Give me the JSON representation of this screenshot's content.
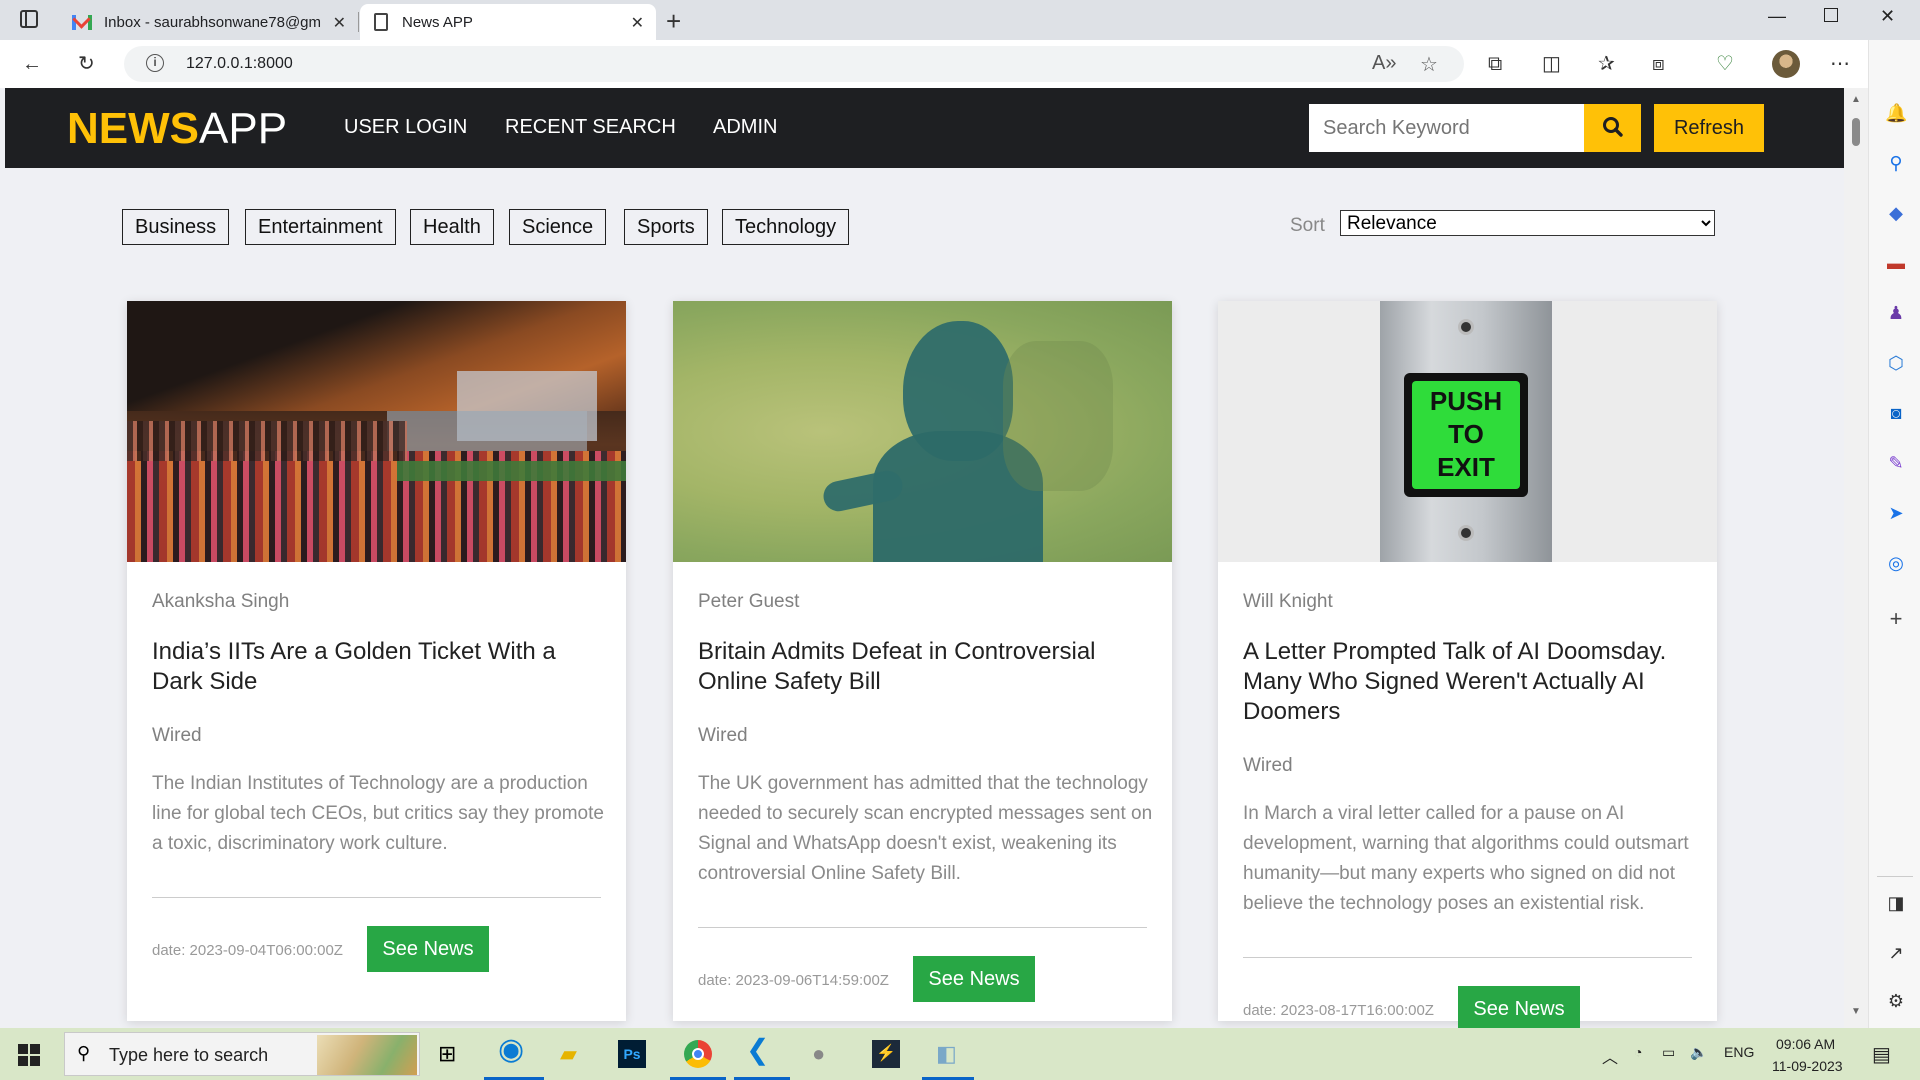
{
  "browser": {
    "tabs": [
      {
        "title": "Inbox - saurabhsonwane78@gm",
        "icon": "gmail-icon",
        "active": false
      },
      {
        "title": "News APP",
        "icon": "document-icon",
        "active": true
      }
    ],
    "url": "127.0.0.1:8000"
  },
  "app": {
    "brand_a": "NEWS",
    "brand_b": "APP",
    "nav": [
      "USER LOGIN",
      "RECENT SEARCH",
      "ADMIN"
    ],
    "search_placeholder": "Search Keyword",
    "refresh_label": "Refresh",
    "categories": [
      "Business",
      "Entertainment",
      "Health",
      "Science",
      "Sports",
      "Technology"
    ],
    "sort_label": "Sort",
    "sort_value": "Relevance",
    "colors": {
      "accent": "#ffc107",
      "header": "#1e1f22",
      "button": "#28a745"
    }
  },
  "articles": [
    {
      "author": "Akanksha Singh",
      "title": "India’s IITs Are a Golden Ticket With a Dark Side",
      "source": "Wired",
      "description": "The Indian Institutes of Technology are a production line for global tech CEOs, but critics say they promote a toxic, discriminatory work culture.",
      "date": "date: 2023-09-04T06:00:00Z",
      "button": "See News"
    },
    {
      "author": "Peter Guest",
      "title": "Britain Admits Defeat in Controversial Online Safety Bill",
      "source": "Wired",
      "description": "The UK government has admitted that the technology needed to securely scan encrypted messages sent on Signal and WhatsApp doesn't exist, weakening its controversial Online Safety Bill.",
      "date": "date: 2023-09-06T14:59:00Z",
      "button": "See News"
    },
    {
      "author": "Will Knight",
      "title": "A Letter Prompted Talk of AI Doomsday. Many Who Signed Weren't Actually AI Doomers",
      "source": "Wired",
      "description": "In March a viral letter called for a pause on AI development, warning that algorithms could outsmart humanity—but many experts who signed on did not believe the technology poses an existential risk.",
      "date": "date: 2023-08-17T16:00:00Z",
      "button": "See News",
      "image_text": [
        "PUSH",
        "TO",
        "EXIT"
      ]
    }
  ],
  "taskbar": {
    "search_placeholder": "Type here to search",
    "language": "ENG",
    "time": "09:06 AM",
    "date": "11-09-2023"
  }
}
